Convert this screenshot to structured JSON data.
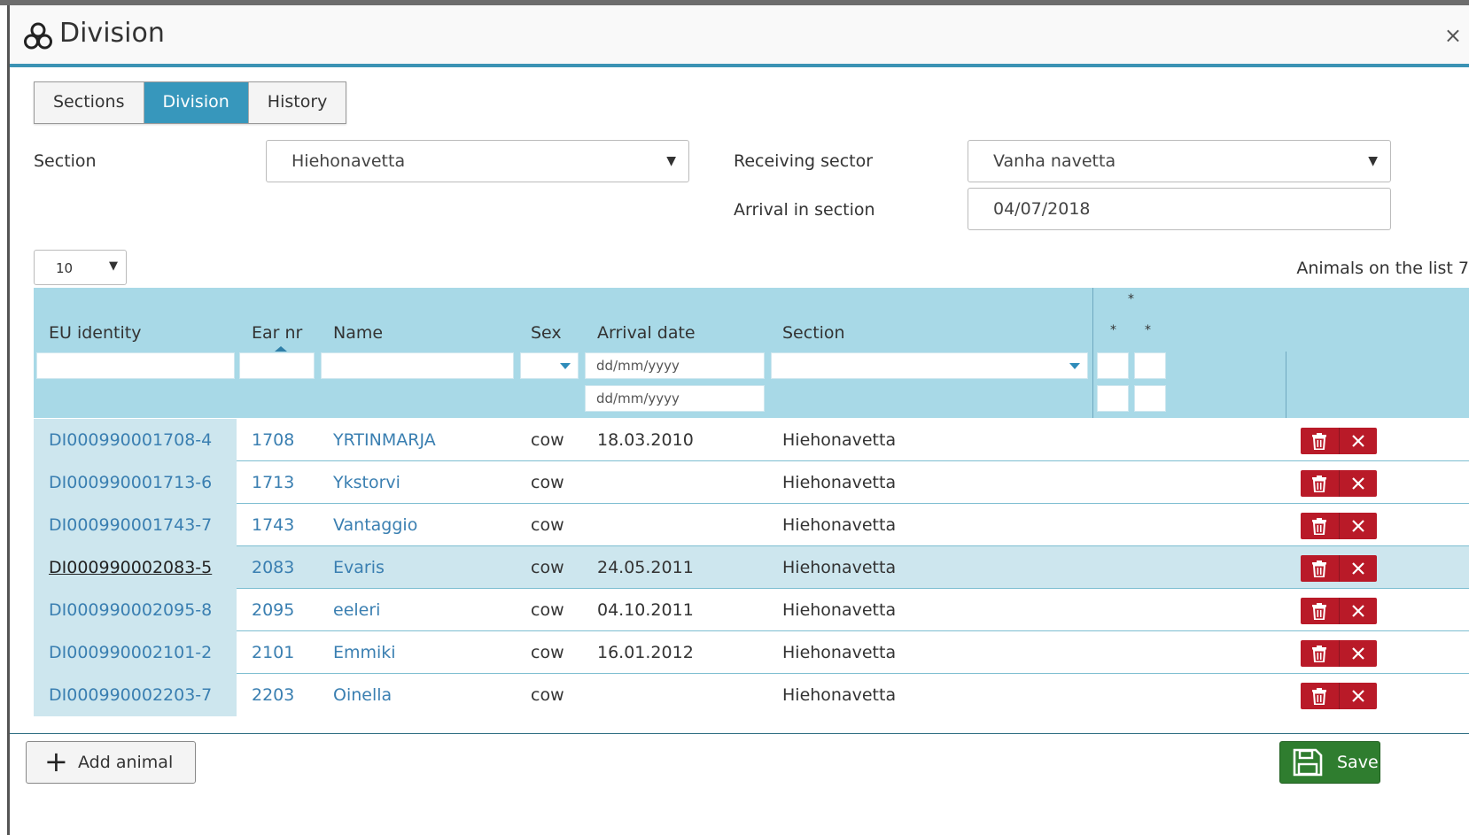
{
  "window": {
    "title": "Division",
    "close": "×"
  },
  "tabs": [
    {
      "label": "Sections",
      "active": false
    },
    {
      "label": "Division",
      "active": true
    },
    {
      "label": "History",
      "active": false
    }
  ],
  "form": {
    "section_label": "Section",
    "section_value": "Hiehonavetta",
    "receiving_label": "Receiving sector",
    "receiving_value": "Vanha navetta",
    "arrival_label": "Arrival in section",
    "arrival_value": "04/07/2018"
  },
  "list": {
    "page_size": "10",
    "count_text": "Animals on the list 7"
  },
  "table": {
    "headers": {
      "eu": "EU identity",
      "ear": "Ear nr",
      "name": "Name",
      "sex": "Sex",
      "arrival": "Arrival date",
      "section": "Section",
      "star": "*"
    },
    "filters": {
      "date_placeholder": "dd/mm/yyyy"
    },
    "rows": [
      {
        "eu": "DI000990001708-4",
        "ear": "1708",
        "name": "YRTINMARJA",
        "sex": "cow",
        "arrival": "18.03.2010",
        "section": "Hiehonavetta"
      },
      {
        "eu": "DI000990001713-6",
        "ear": "1713",
        "name": "Ykstorvi",
        "sex": "cow",
        "arrival": "",
        "section": "Hiehonavetta"
      },
      {
        "eu": "DI000990001743-7",
        "ear": "1743",
        "name": "Vantaggio",
        "sex": "cow",
        "arrival": "",
        "section": "Hiehonavetta"
      },
      {
        "eu": "DI000990002083-5",
        "ear": "2083",
        "name": "Evaris",
        "sex": "cow",
        "arrival": "24.05.2011",
        "section": "Hiehonavetta"
      },
      {
        "eu": "DI000990002095-8",
        "ear": "2095",
        "name": "eeleri",
        "sex": "cow",
        "arrival": "04.10.2011",
        "section": "Hiehonavetta"
      },
      {
        "eu": "DI000990002101-2",
        "ear": "2101",
        "name": "Emmiki",
        "sex": "cow",
        "arrival": "16.01.2012",
        "section": "Hiehonavetta"
      },
      {
        "eu": "DI000990002203-7",
        "ear": "2203",
        "name": "Oinella",
        "sex": "cow",
        "arrival": "",
        "section": "Hiehonavetta"
      }
    ]
  },
  "footer": {
    "add_label": "Add animal",
    "save_label": "Save"
  },
  "colors": {
    "accent": "#3797bc",
    "header_bg": "#a8d9e7",
    "delete": "#b91a28",
    "save": "#2f7d2f"
  }
}
